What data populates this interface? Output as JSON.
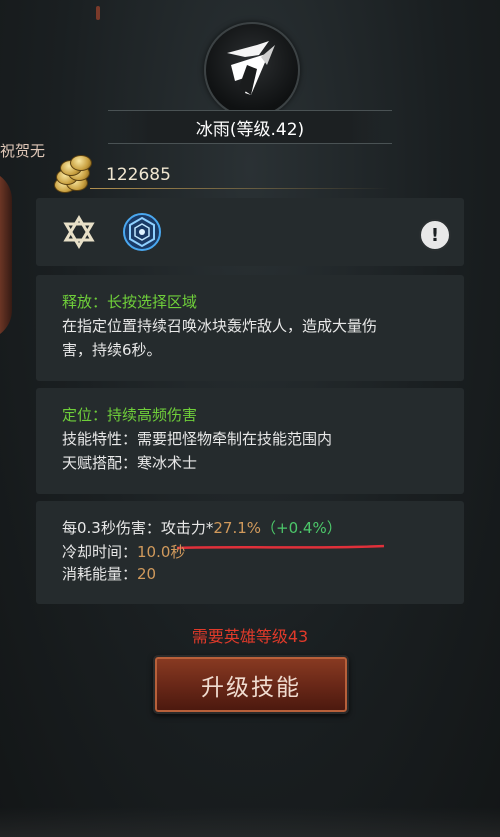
{
  "skill": {
    "icon": "ice-rain-skill-icon",
    "title": "冰雨(等级.42)"
  },
  "ribbon_text": "祝贺无",
  "currency": {
    "icon": "gold-coins-icon",
    "amount": "122685"
  },
  "tags": [
    {
      "icon": "star-of-david-icon"
    },
    {
      "icon": "blue-hex-rune-icon"
    },
    {
      "icon": "info-icon",
      "label": "!"
    }
  ],
  "release": {
    "heading": "释放：长按选择区域",
    "line1": "在指定位置持续召唤冰块轰炸敌人，造成大量伤",
    "line2": "害，持续6秒。"
  },
  "position": {
    "heading": "定位：持续高频伤害",
    "line1": "技能特性：需要把怪物牵制在技能范围内",
    "line2": "天赋搭配：寒冰术士"
  },
  "stats": {
    "damage_label": "每0.3秒伤害：",
    "damage_attr": "攻击力*",
    "damage_value": "27.1%",
    "damage_bonus": "（+0.4%）",
    "cooldown_label": "冷却时间：",
    "cooldown_value": "10.0秒",
    "energy_label": "消耗能量：",
    "energy_value": "20"
  },
  "requirement": "需要英雄等级43",
  "upgrade_button": "升级技能",
  "colors": {
    "accent_green": "#6fcf3a",
    "stat_orange": "#d19a5c",
    "warning_red": "#e03a2a",
    "button_bg": "#6a2818"
  }
}
